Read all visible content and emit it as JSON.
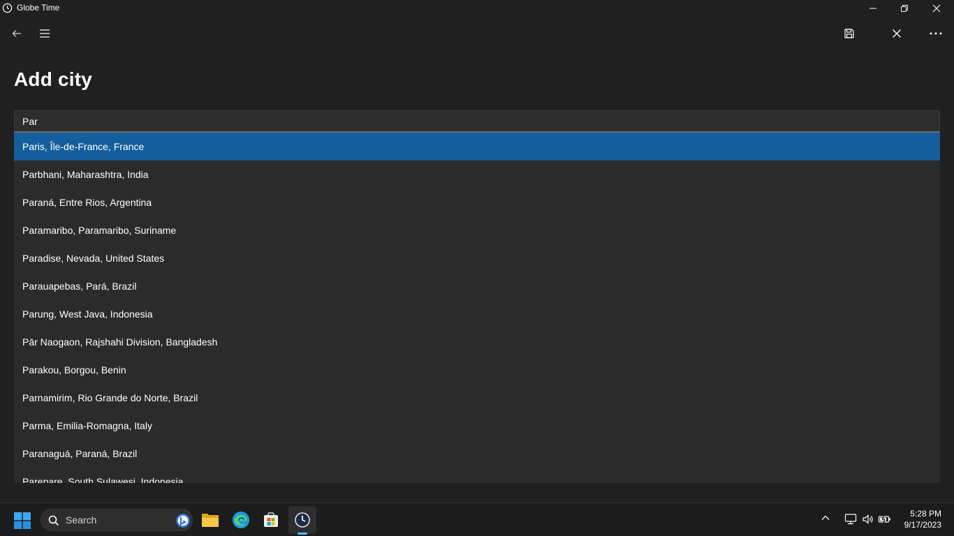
{
  "window": {
    "title": "Globe Time",
    "icons": {
      "app": "globe-clock-icon",
      "minimize": "minimize-icon",
      "maximize": "restore-icon",
      "close": "close-icon"
    }
  },
  "command_bar": {
    "icons": {
      "back": "back-arrow-icon",
      "menu": "hamburger-menu-icon",
      "save": "save-icon",
      "cancel": "close-icon",
      "more": "more-icon"
    }
  },
  "page": {
    "title": "Add city"
  },
  "search": {
    "value": "Par"
  },
  "suggestions": [
    "Paris, Île-de-France, France",
    "Parbhani, Maharashtra, India",
    "Paraná, Entre Rios, Argentina",
    "Paramaribo, Paramaribo, Suriname",
    "Paradise, Nevada, United States",
    "Parauapebas, Pará, Brazil",
    "Parung, West Java, Indonesia",
    "Pār Naogaon, Rajshahi Division, Bangladesh",
    "Parakou, Borgou, Benin",
    "Parnamirim, Rio Grande do Norte, Brazil",
    "Parma, Emilia-Romagna, Italy",
    "Paranaguá, Paraná, Brazil",
    "Parepare, South Sulawesi, Indonesia"
  ],
  "selected_index": 0,
  "colors": {
    "background": "#202020",
    "list_background": "#2b2b2b",
    "selected": "#155e9c",
    "accent": "#4cc2ff"
  },
  "taskbar": {
    "search_label": "Search",
    "time": "5:28 PM",
    "date": "9/17/2023",
    "icons": [
      "windows-start-icon",
      "search-icon",
      "bing-icon",
      "file-explorer-icon",
      "edge-icon",
      "store-icon",
      "globe-time-icon",
      "chevron-up-icon",
      "network-icon",
      "volume-icon",
      "battery-icon"
    ]
  }
}
